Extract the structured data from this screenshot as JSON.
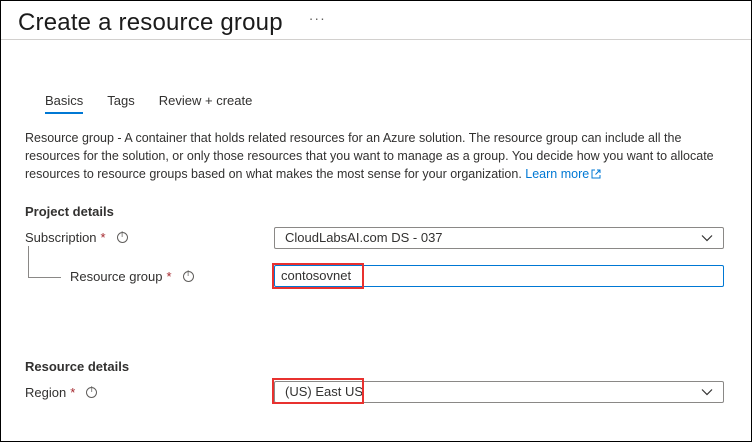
{
  "header": {
    "title": "Create a resource group",
    "more_label": "···"
  },
  "tabs": [
    {
      "label": "Basics",
      "active": true
    },
    {
      "label": "Tags",
      "active": false
    },
    {
      "label": "Review + create",
      "active": false
    }
  ],
  "description": {
    "text": "Resource group - A container that holds related resources for an Azure solution. The resource group can include all the resources for the solution, or only those resources that you want to manage as a group. You decide how you want to allocate resources to resource groups based on what makes the most sense for your organization.",
    "link_label": "Learn more"
  },
  "project_details": {
    "heading": "Project details",
    "subscription": {
      "label": "Subscription",
      "required_marker": "*",
      "value": "CloudLabsAI.com DS - 037"
    },
    "resource_group": {
      "label": "Resource group",
      "required_marker": "*",
      "value": "contosovnet"
    }
  },
  "resource_details": {
    "heading": "Resource details",
    "region": {
      "label": "Region",
      "required_marker": "*",
      "value": "(US) East US"
    }
  },
  "colors": {
    "accent": "#0078d4",
    "required": "#a4262c",
    "highlight": "#e8312f"
  },
  "icons": [
    "more-icon",
    "external-link-icon",
    "info-icon",
    "chevron-down-icon"
  ]
}
